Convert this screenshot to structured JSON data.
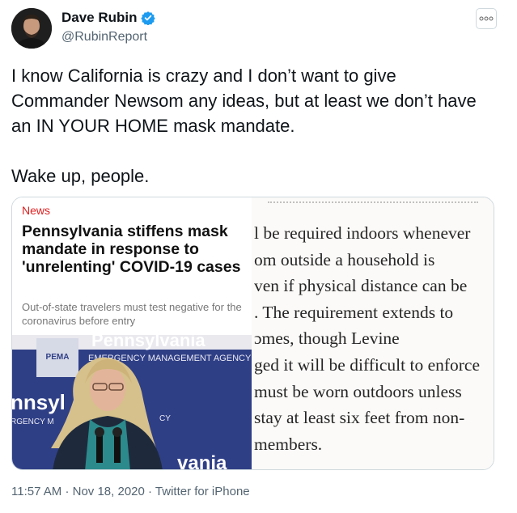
{
  "author": {
    "display_name": "Dave Rubin",
    "handle": "@RubinReport",
    "verified": true,
    "avatar_icon": "profile-photo",
    "verified_icon": "verified-badge-icon"
  },
  "menu_icon": "more-options-icon",
  "tweet": {
    "paragraph1": "I know California is crazy and I don’t want to give Commander Newsom any ideas, but at least we don’t have an IN YOUR HOME mask mandate.",
    "paragraph2": "Wake up, people."
  },
  "media": {
    "article": {
      "section": "News",
      "headline": "Pennsylvania stiffens mask mandate in response to 'unrelenting' COVID-19 cases",
      "subhead": "Out-of-state travelers must test negative for the coronavirus before entry"
    },
    "photo": {
      "banner_top": "Pennsylvania",
      "banner_sub": "EMERGENCY MANAGEMENT AGENCY",
      "pema": "PEMA",
      "left_big": "nnsyl",
      "left_sub": "RGENCY M",
      "mid_sub": "CY",
      "bottom": "vania"
    },
    "scan_lines": [
      "l be required indoors whenever",
      "om outside a household is",
      "ven if physical distance can be",
      ". The requirement extends to",
      "ɔmes, though Levine",
      "ged it will be difficult to enforce",
      "must be worn outdoors unless",
      "stay at least six feet from non-",
      "members."
    ]
  },
  "meta": {
    "time": "11:57 AM",
    "separator": "·",
    "date": "Nov 18, 2020",
    "source": "Twitter for iPhone"
  },
  "colors": {
    "verified": "#1d9bf0",
    "news_red": "#e02020",
    "secondary_text": "#536471",
    "border": "#cfd9de",
    "photo_blue": "#2f3f86"
  }
}
